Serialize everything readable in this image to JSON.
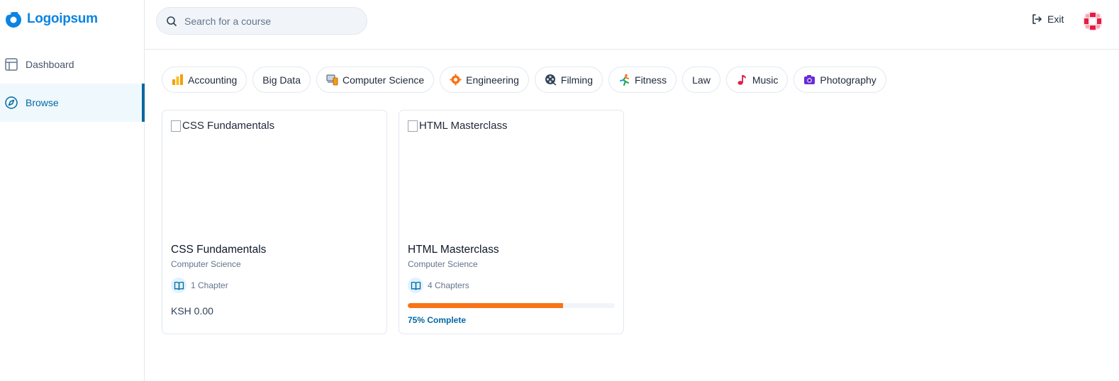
{
  "brand": {
    "name": "Logoipsum",
    "color": "#0b84e3"
  },
  "sidebar": {
    "items": [
      {
        "label": "Dashboard",
        "icon": "layout-icon",
        "active": false
      },
      {
        "label": "Browse",
        "icon": "compass-icon",
        "active": true
      }
    ]
  },
  "topbar": {
    "search_placeholder": "Search for a course",
    "exit_label": "Exit"
  },
  "categories": [
    {
      "label": "Accounting",
      "icon": "bar-chart-icon"
    },
    {
      "label": "Big Data",
      "icon": ""
    },
    {
      "label": "Computer Science",
      "icon": "devices-icon"
    },
    {
      "label": "Engineering",
      "icon": "gear-icon"
    },
    {
      "label": "Filming",
      "icon": "film-reel-icon"
    },
    {
      "label": "Fitness",
      "icon": "runner-icon"
    },
    {
      "label": "Law",
      "icon": ""
    },
    {
      "label": "Music",
      "icon": "music-note-icon"
    },
    {
      "label": "Photography",
      "icon": "camera-icon"
    }
  ],
  "courses": [
    {
      "image_alt": "CSS Fundamentals",
      "title": "CSS Fundamentals",
      "category": "Computer Science",
      "chapters": "1 Chapter",
      "price": "KSH 0.00"
    },
    {
      "image_alt": "HTML Masterclass",
      "title": "HTML Masterclass",
      "category": "Computer Science",
      "chapters": "4 Chapters",
      "progress_percent": 75,
      "progress_label": "75% Complete"
    }
  ],
  "colors": {
    "accent": "#0369a1",
    "progress": "#f97316"
  }
}
